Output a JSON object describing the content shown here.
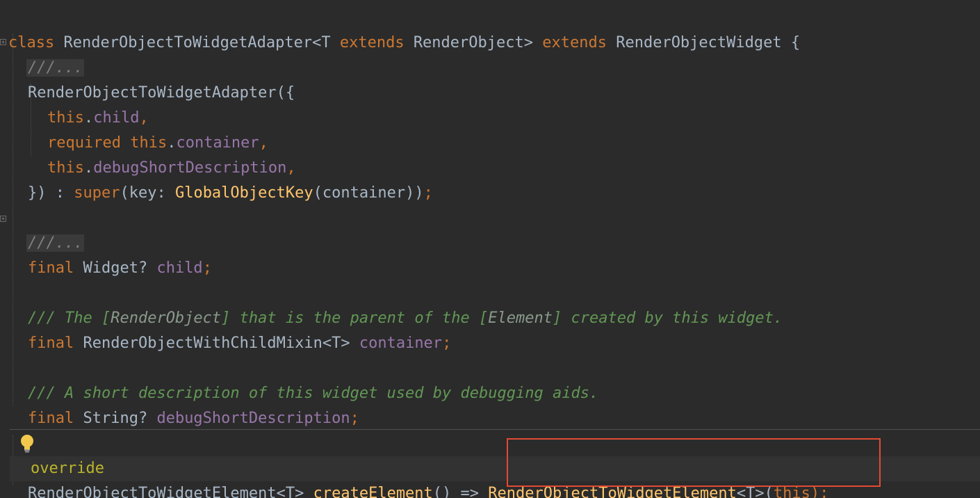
{
  "editor": {
    "lines": {
      "l1": {
        "class_kw": "class",
        "class_name": "RenderObjectToWidgetAdapter<T",
        "extends1": "extends",
        "render_object": "RenderObject>",
        "extends2": "extends",
        "base": "RenderObjectWidget {"
      },
      "l2": {
        "folded": "///..."
      },
      "l3": {
        "ctor": "RenderObjectToWidgetAdapter({"
      },
      "l4": {
        "this_kw": "this",
        "dot": ".",
        "field": "child",
        "comma": ","
      },
      "l5": {
        "required_kw": "required",
        "this_kw": "this",
        "dot": ".",
        "field": "container",
        "comma": ","
      },
      "l6": {
        "this_kw": "this",
        "dot": ".",
        "field": "debugShortDescription",
        "comma": ","
      },
      "l7": {
        "open": "}) : ",
        "super_kw": "super",
        "key_part": "(key: ",
        "fn": "GlobalObjectKey",
        "tail": "(container))",
        "semi": ";"
      },
      "l8": {
        "folded": "///..."
      },
      "l9": {
        "final_kw": "final",
        "type": "Widget?",
        "field": "child",
        "semi": ";"
      },
      "l10": {
        "doc1": "/// The [",
        "ref1": "RenderObject",
        "doc2": "] that is the parent of the [",
        "ref2": "Element",
        "doc3": "] created by this widget."
      },
      "l11": {
        "final_kw": "final",
        "type": "RenderObjectWithChildMixin<T>",
        "field": "container",
        "semi": ";"
      },
      "l12": {
        "doc": "/// A short description of this widget used by debugging aids."
      },
      "l13": {
        "final_kw": "final",
        "type": "String?",
        "field": "debugShortDescription",
        "semi": ";"
      },
      "l14": {
        "annotation": "override"
      },
      "l15": {
        "ret_type": "RenderObjectToWidgetElement<T>",
        "method": "createElement",
        "arrow": "() =>",
        "ctor": "RenderObjectToWidgetElement",
        "generic": "<T>(",
        "this_kw": "this",
        "close": ");"
      }
    }
  },
  "colors": {
    "background": "#2b2b2b",
    "keyword": "#cc7832",
    "field": "#9876aa",
    "function": "#ffc66d",
    "doc_comment": "#629755",
    "default_text": "#a9b7c6",
    "highlight_border": "#e24b33",
    "bulb": "#f2c94c"
  },
  "icons": {
    "bulb": "lightbulb-icon",
    "fold": "fold-marker-icon"
  }
}
